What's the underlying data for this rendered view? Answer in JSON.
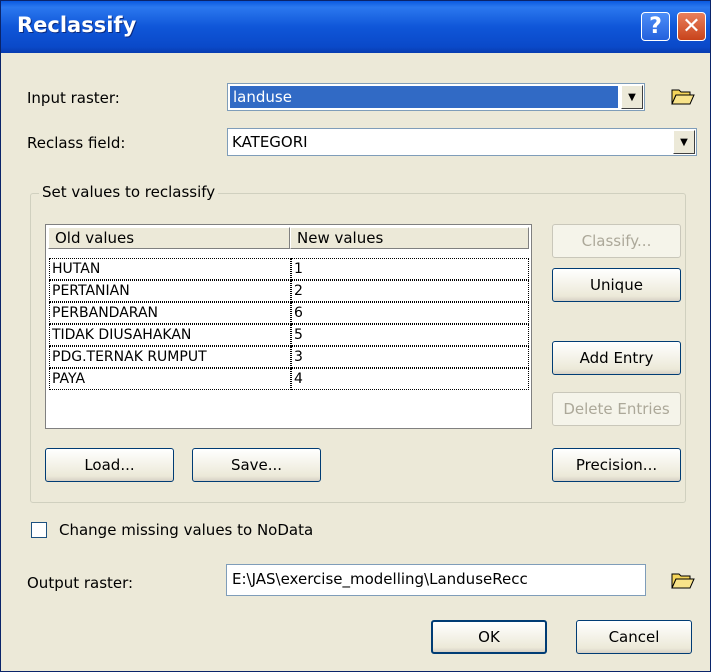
{
  "window": {
    "title": "Reclassify",
    "help_glyph": "?",
    "close_glyph": "✕"
  },
  "input_raster": {
    "label": "Input raster:",
    "value": "landuse"
  },
  "reclass_field": {
    "label": "Reclass field:",
    "value": "KATEGORI"
  },
  "group": {
    "legend": "Set values to reclassify",
    "columns": [
      "Old values",
      "New values"
    ],
    "rows": [
      {
        "old": "HUTAN",
        "new": "1"
      },
      {
        "old": "PERTANIAN",
        "new": "2"
      },
      {
        "old": "PERBANDARAN",
        "new": "6"
      },
      {
        "old": "TIDAK DIUSAHAKAN",
        "new": "5"
      },
      {
        "old": "PDG.TERNAK RUMPUT",
        "new": "3"
      },
      {
        "old": "PAYA",
        "new": "4"
      }
    ],
    "buttons": {
      "classify": "Classify...",
      "unique": "Unique",
      "add_entry": "Add Entry",
      "delete_entries": "Delete Entries",
      "load": "Load...",
      "save": "Save...",
      "precision": "Precision..."
    }
  },
  "missing_nodata": {
    "label": "Change missing values to NoData",
    "checked": false
  },
  "output_raster": {
    "label": "Output raster:",
    "value": "E:\\JAS\\exercise_modelling\\LanduseRecc"
  },
  "footer": {
    "ok": "OK",
    "cancel": "Cancel"
  },
  "colors": {
    "title_bar": "#0a49c9",
    "selection": "#316ac5",
    "dialog_bg": "#ece9d8"
  },
  "icons": [
    "help-icon",
    "close-icon",
    "open-folder-icon",
    "dropdown-arrow-icon"
  ]
}
